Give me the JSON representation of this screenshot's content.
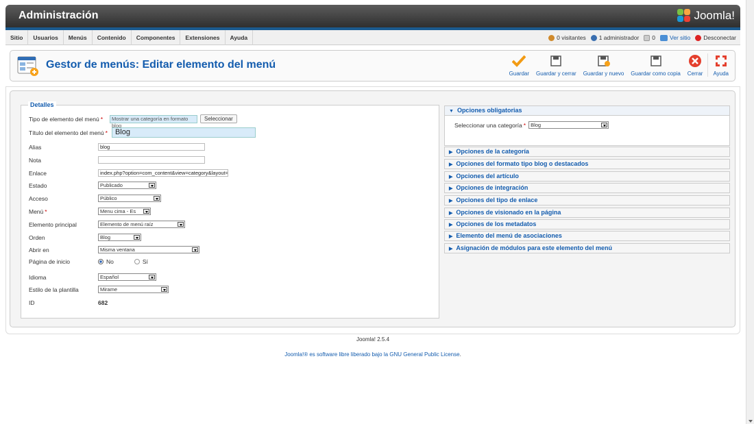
{
  "header": {
    "title": "Administración",
    "logo_text": "Joomla!"
  },
  "menubar": {
    "items": [
      "Sitio",
      "Usuarios",
      "Menús",
      "Contenido",
      "Componentes",
      "Extensiones",
      "Ayuda"
    ],
    "status": {
      "visitors": "0 visitantes",
      "admins": "1 administrador",
      "messages": "0",
      "view_site": "Ver sitio",
      "logout": "Desconectar"
    }
  },
  "page": {
    "title": "Gestor de menús: Editar elemento del menú"
  },
  "toolbar": {
    "save": "Guardar",
    "save_close": "Guardar y cerrar",
    "save_new": "Guardar y nuevo",
    "save_copy": "Guardar como copia",
    "close": "Cerrar",
    "help": "Ayuda"
  },
  "details": {
    "legend": "Detalles",
    "menu_type_label": "Tipo de elemento del menú",
    "menu_type_value": "Mostrar una categoría en formato blog",
    "select_button": "Seleccionar",
    "title_label": "Título del elemento del menú",
    "title_value": "Blog",
    "alias_label": "Alias",
    "alias_value": "blog",
    "note_label": "Nota",
    "note_value": "",
    "link_label": "Enlace",
    "link_value": "index.php?option=com_content&view=category&layout=b",
    "status_label": "Estado",
    "status_value": "Publicado",
    "access_label": "Acceso",
    "access_value": "Público",
    "menu_label": "Menú",
    "menu_value": "Menu cima - Es",
    "parent_label": "Elemento principal",
    "parent_value": "Elemento de menú raíz",
    "order_label": "Orden",
    "order_value": "Blog",
    "open_label": "Abrir en",
    "open_value": "Misma ventana",
    "home_label": "Página de inicio",
    "home_no": "No",
    "home_yes": "Sí",
    "language_label": "Idioma",
    "language_value": "Español",
    "template_label": "Estilo de la plantilla",
    "template_value": "Mirame",
    "id_label": "ID",
    "id_value": "682"
  },
  "options": {
    "required_title": "Opciones obligatorias",
    "category_label": "Seleccionar una categoría",
    "category_value": "Blog",
    "panels": [
      "Opciones de la categoría",
      "Opciones del formato tipo blog o destacados",
      "Opciones del artículo",
      "Opciones de integración",
      "Opciones del tipo de enlace",
      "Opciones de visionado en la página",
      "Opciones de los metadatos",
      "Elemento del menú de asociaciones",
      "Asignación de módulos para este elemento del menú"
    ]
  },
  "footer": {
    "version": "Joomla! 2.5.4",
    "license_prefix": "Joomla!® es software libre liberado bajo la ",
    "license_link": "GNU General Public License",
    "license_suffix": "."
  }
}
